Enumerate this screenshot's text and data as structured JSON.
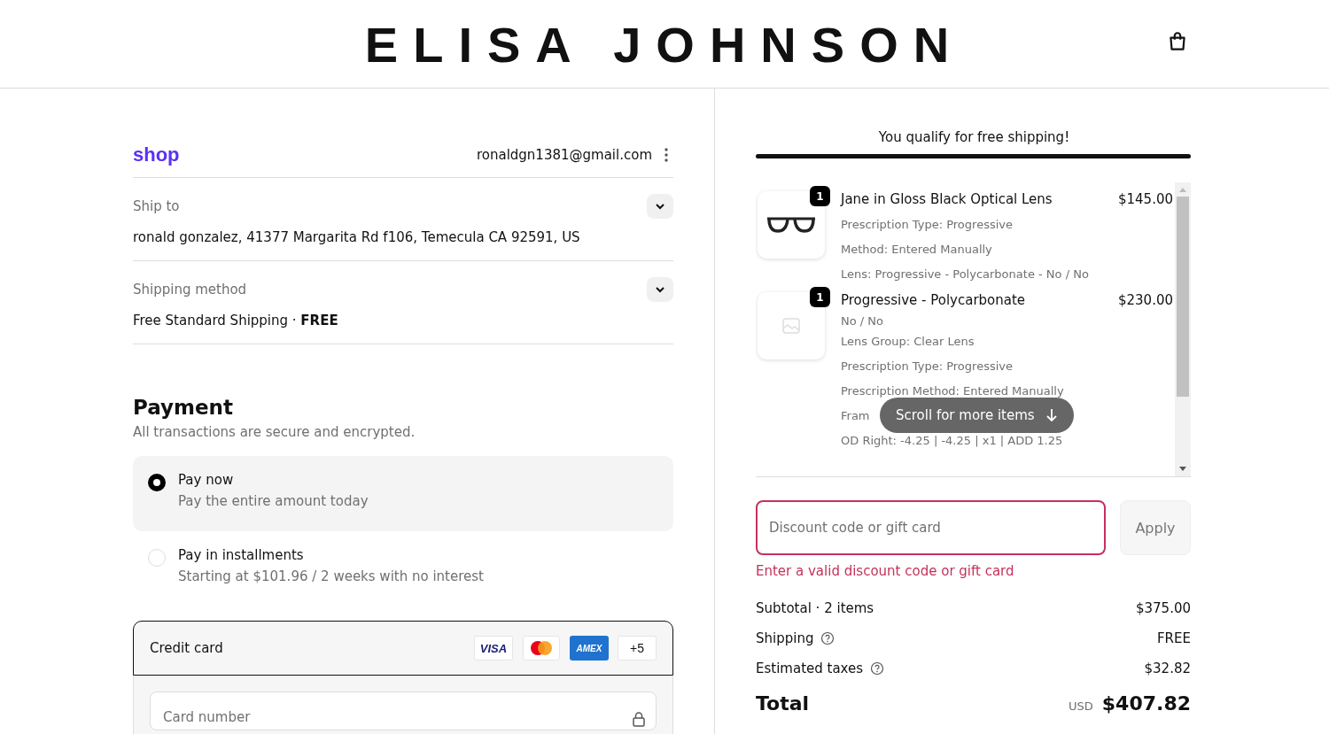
{
  "header": {
    "logo": "ELISA JOHNSON"
  },
  "account": {
    "brand": "shop",
    "email": "ronaldgn1381@gmail.com"
  },
  "review": [
    {
      "label": "Ship to",
      "value": "ronald gonzalez, 41377 Margarita Rd f106, Temecula CA 92591, US"
    },
    {
      "label": "Shipping method",
      "value": "Free Standard Shipping · **FREE**"
    }
  ],
  "payment": {
    "title": "Payment",
    "subtitle": "All transactions are secure and encrypted.",
    "options": [
      {
        "label": "Pay now",
        "detail": "Pay the entire amount today",
        "selected": true
      },
      {
        "label": "Pay in installments",
        "detail": "Starting at $101.96 / 2 weeks with no interest",
        "selected": false
      }
    ],
    "credit_card": {
      "label": "Credit card",
      "brands": [
        "VISA",
        "AMEX"
      ],
      "more": "+5",
      "placeholder": "Card number"
    }
  },
  "free_shipping": {
    "message": "You qualify for free shipping!",
    "level": 1
  },
  "items": [
    {
      "quantity": "1",
      "name": "Jane in Gloss Black Optical Lens",
      "price": "$145.00",
      "kind": "glasses",
      "details": [
        "Prescription Type: Progressive",
        "Method: Entered Manually",
        "Lens: Progressive - Polycarbonate - No / No"
      ]
    },
    {
      "quantity": "1",
      "name": "Progressive - Polycarbonate",
      "price": "$230.00",
      "kind": "placeholder",
      "details": [
        "No / No",
        "Lens Group: Clear Lens",
        "Prescription Type: Progressive",
        "Prescription Method: Entered Manually",
        "Fram",
        "OD Right: -4.25 | -4.25 | x1 | ADD 1.25"
      ]
    }
  ],
  "scroll_hint": "Scroll for more items",
  "discount": {
    "placeholder": "Discount code or gift card",
    "button": "Apply",
    "error": "Enter a valid discount code or gift card"
  },
  "summary": [
    {
      "label": "Subtotal · 2 items",
      "value": "$375.00",
      "help": false
    },
    {
      "label": "Shipping",
      "value": "FREE",
      "help": true
    },
    {
      "label": "Estimated taxes",
      "value": "$32.82",
      "help": true
    }
  ],
  "total": {
    "label": "Total",
    "currency": "USD",
    "amount": "$407.82"
  }
}
